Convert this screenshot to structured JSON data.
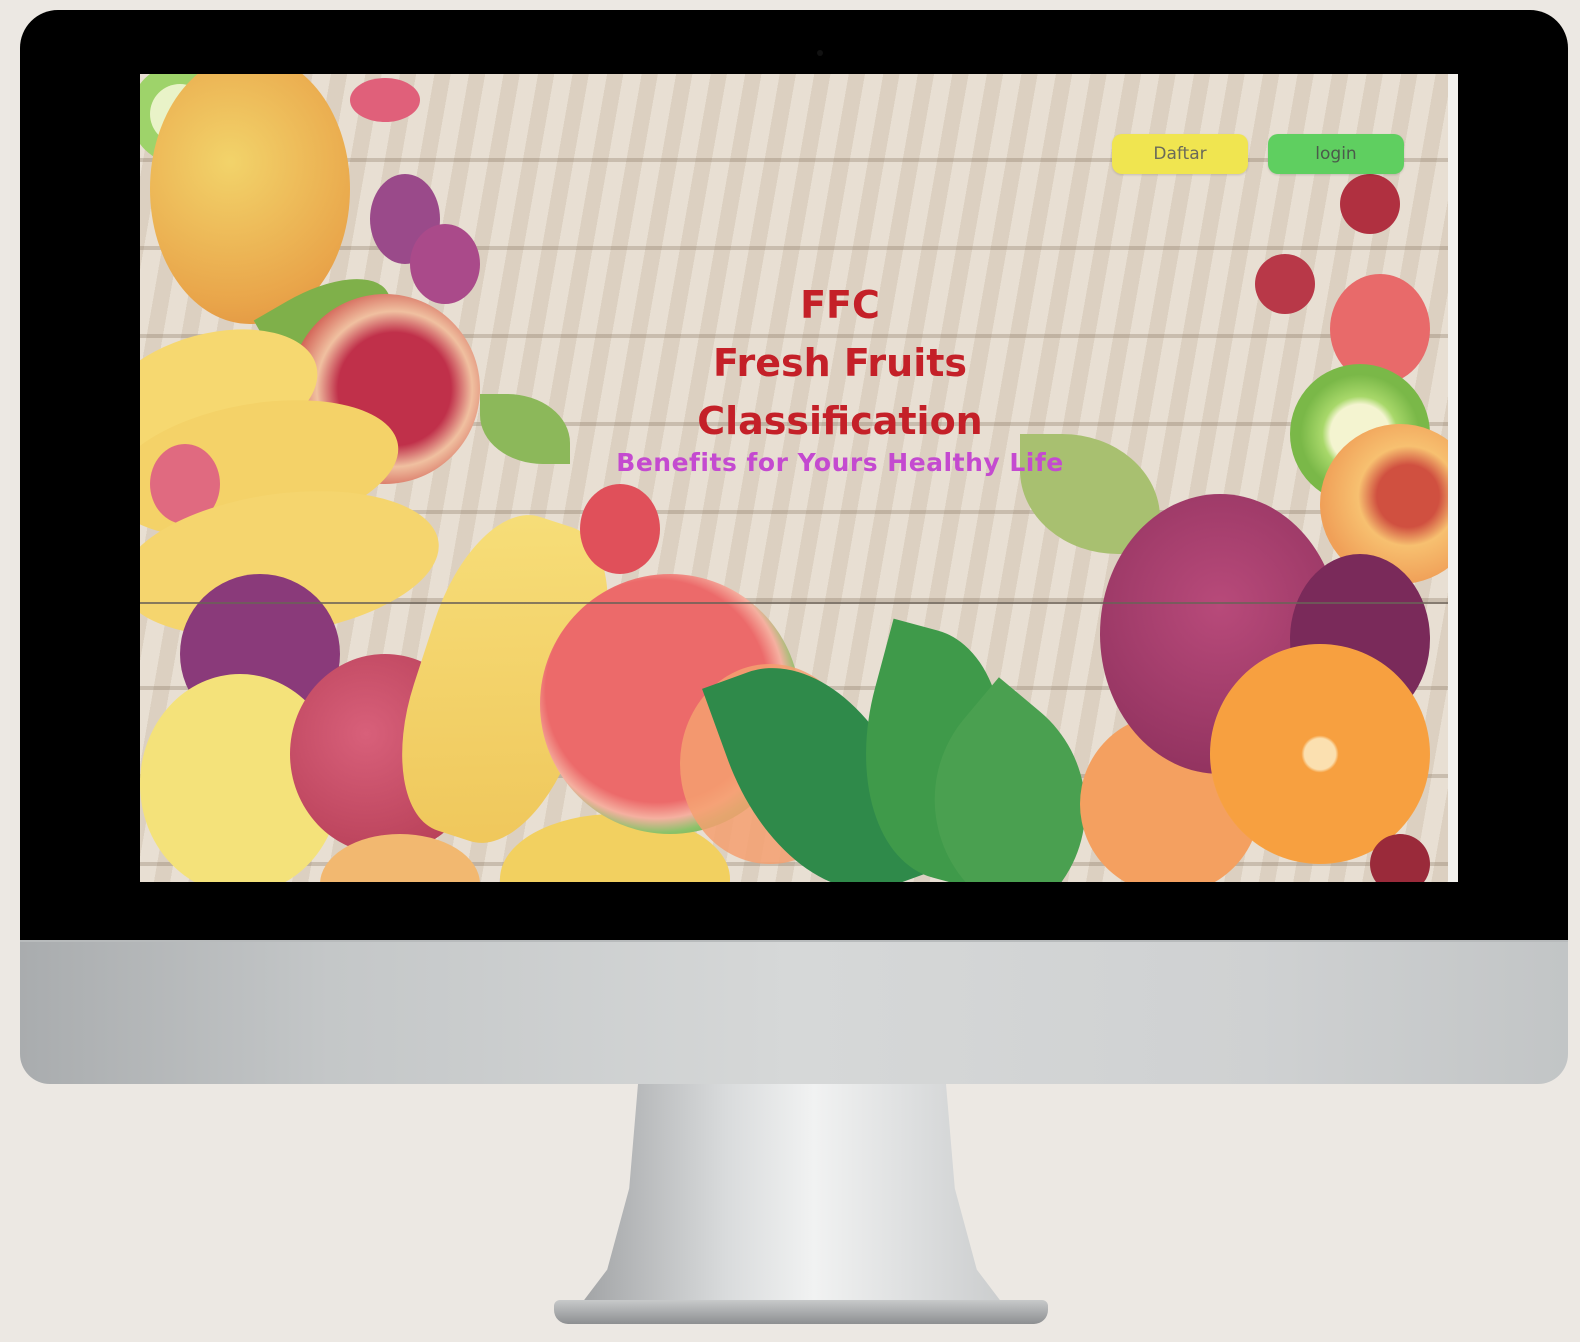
{
  "header": {
    "register_label": "Daftar",
    "login_label": "login"
  },
  "hero": {
    "line1": "FFC",
    "line2": "Fresh Fruits",
    "line3": "Classification",
    "tagline": "Benefits for Yours Healthy Life"
  },
  "colors": {
    "title": "#c42028",
    "tagline": "#c44ad0",
    "register_button": "#f0e550",
    "login_button": "#5fcf60"
  }
}
